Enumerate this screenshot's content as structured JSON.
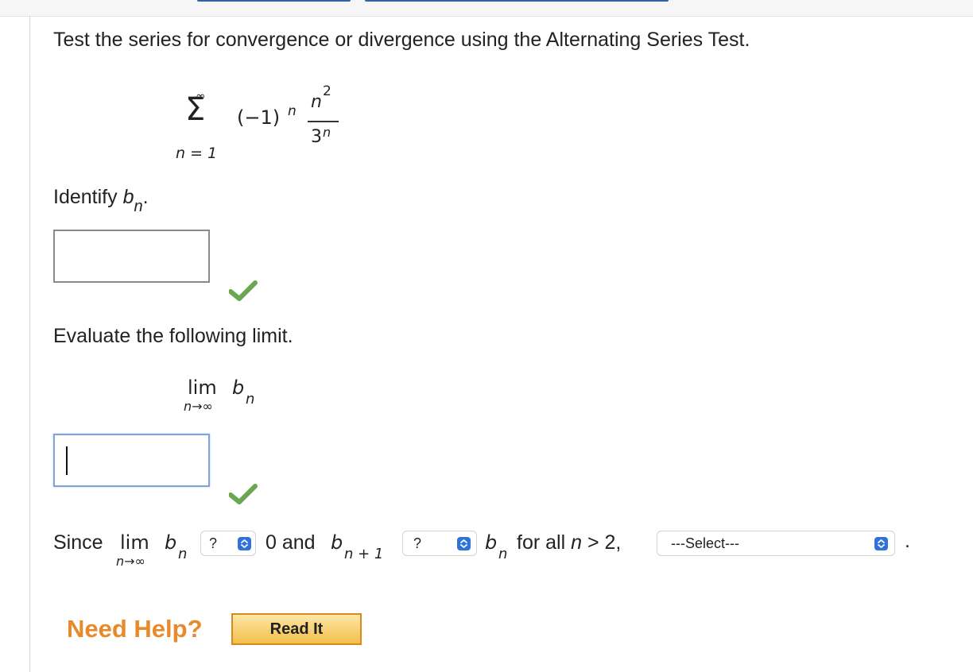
{
  "question": {
    "instruction": "Test the series for convergence or divergence using the Alternating Series Test."
  },
  "series": {
    "sigma": "Σ",
    "upper": "∞",
    "lower": "n = 1",
    "sign_term": "(−1)",
    "sign_exp": "n",
    "numerator_base": "n",
    "numerator_exp": "2",
    "denominator_base": "3",
    "denominator_exp": "n"
  },
  "part1": {
    "prompt": "Identify",
    "var": "b",
    "sub": "n",
    "end": ".",
    "answer_value": ""
  },
  "part2": {
    "prompt": "Evaluate the following limit.",
    "lim": "lim",
    "under": "n→∞",
    "var": "b",
    "sub": "n",
    "answer_value": ""
  },
  "part3": {
    "since": "Since",
    "lim": "lim",
    "under": "n→∞",
    "var": "b",
    "sub": "n",
    "select1_value": "?",
    "text_mid": "0 and",
    "b2": "b",
    "sub2": "n + 1",
    "select2_value": "?",
    "b3": "b",
    "sub3": "n",
    "for_all": "for all",
    "n_var": "n",
    "condition": "> 2,",
    "select3_value": "---Select---",
    "period": "."
  },
  "help": {
    "label": "Need Help?",
    "read_it": "Read It"
  },
  "colors": {
    "check": "#6aa84f",
    "help": "#e8892a",
    "select_arrow": "#2f73d8"
  },
  "icons": {
    "check1": "check-icon",
    "check2": "check-icon",
    "select_arrows": "updown-chevron-icon"
  }
}
